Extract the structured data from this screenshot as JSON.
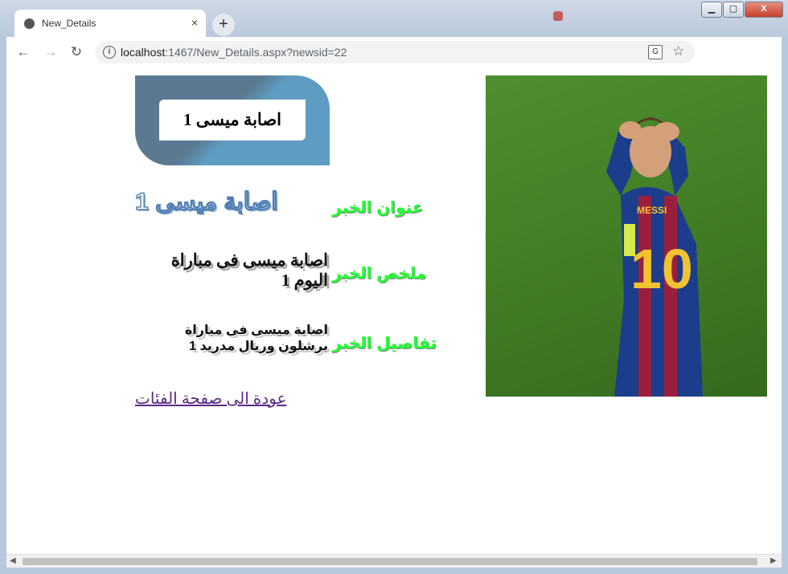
{
  "browser": {
    "tab_title": "New_Details",
    "tab_close": "×",
    "new_tab": "+",
    "url_host": "localhost",
    "url_rest": ":1467/New_Details.aspx?newsid=22",
    "icons": [
      "globe-icon",
      "back-icon",
      "forward-icon",
      "reload-icon",
      "info-icon",
      "translate-icon",
      "star-icon"
    ]
  },
  "window": {
    "minimize": "▁",
    "maximize": "▢",
    "close": "X"
  },
  "news": {
    "card_title": "اصابة ميسى 1",
    "title_label": "عنوان الخبر",
    "title_value": "اصابة ميسى 1",
    "summary_label": "ملخص الخبر",
    "summary_value": "اصابة ميسى فى مباراة اليوم 1",
    "details_label": "تفاصيل الخبر",
    "details_value": "اصابة ميسى فى مباراة برشلون وريال مدريد 1",
    "back_link": "عودة الى صفحة الفئات"
  },
  "photo": {
    "jersey_name": "MESSI",
    "jersey_number": "10"
  }
}
